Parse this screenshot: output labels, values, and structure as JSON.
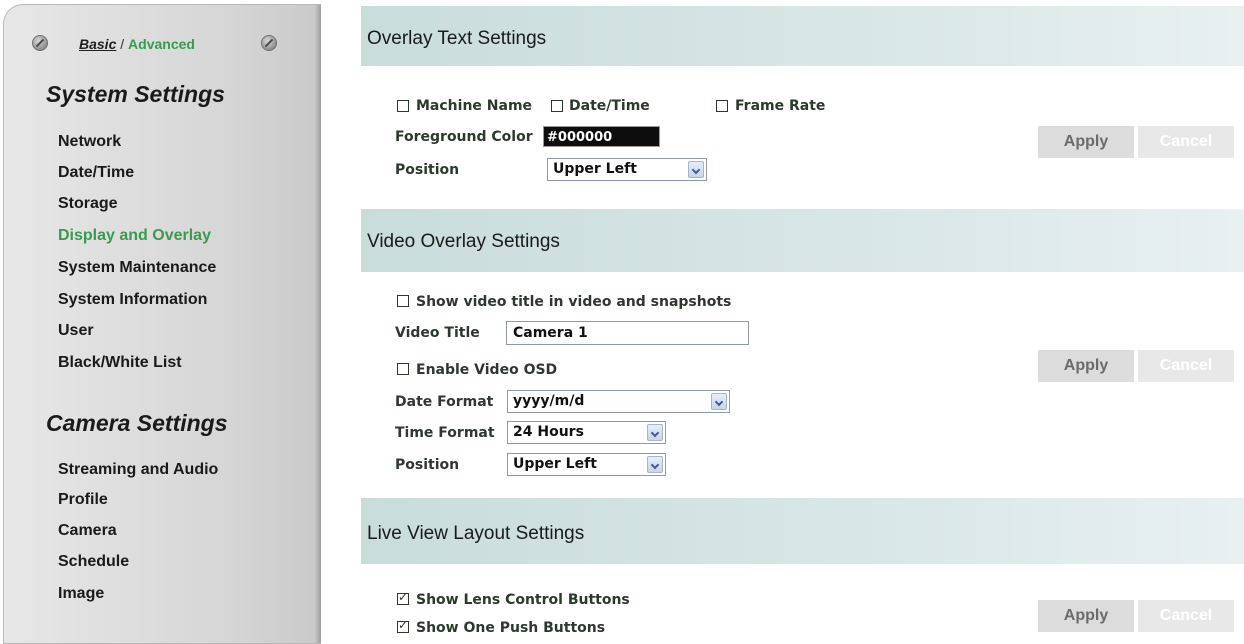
{
  "sidebar": {
    "mode_basic": "Basic",
    "mode_separator": " / ",
    "mode_advanced": "Advanced",
    "system_title": "System Settings",
    "system_items": [
      "Network",
      "Date/Time",
      "Storage",
      "Display and Overlay",
      "System Maintenance",
      "System Information",
      "User",
      "Black/White List"
    ],
    "active_item": "Display and Overlay",
    "camera_title": "Camera Settings",
    "camera_items": [
      "Streaming and Audio",
      "Profile",
      "Camera",
      "Schedule",
      "Image"
    ]
  },
  "overlay_text": {
    "title": "Overlay Text Settings",
    "machine_name_label": "Machine Name",
    "machine_name_checked": false,
    "date_time_label": "Date/Time",
    "date_time_checked": false,
    "frame_rate_label": "Frame Rate",
    "frame_rate_checked": false,
    "foreground_color_label": "Foreground Color",
    "foreground_color_value": "#000000",
    "position_label": "Position",
    "position_value": "Upper Left",
    "apply_label": "Apply",
    "cancel_label": "Cancel"
  },
  "video_overlay": {
    "title": "Video Overlay Settings",
    "show_title_label": "Show video title in video and snapshots",
    "show_title_checked": false,
    "video_title_label": "Video Title",
    "video_title_value": "Camera 1",
    "enable_osd_label": "Enable Video OSD",
    "enable_osd_checked": false,
    "date_format_label": "Date Format",
    "date_format_value": "yyyy/m/d",
    "time_format_label": "Time Format",
    "time_format_value": "24 Hours",
    "position_label": "Position",
    "position_value": "Upper Left",
    "apply_label": "Apply",
    "cancel_label": "Cancel"
  },
  "live_view": {
    "title": "Live View Layout Settings",
    "lens_control_label": "Show Lens Control Buttons",
    "lens_control_checked": true,
    "one_push_label": "Show One Push Buttons",
    "one_push_checked": true,
    "apply_label": "Apply",
    "cancel_label": "Cancel"
  },
  "colors": {
    "accent_green": "#3a9a4f",
    "band_teal": "#d0e2e2",
    "label_text": "#2b3a2b"
  }
}
